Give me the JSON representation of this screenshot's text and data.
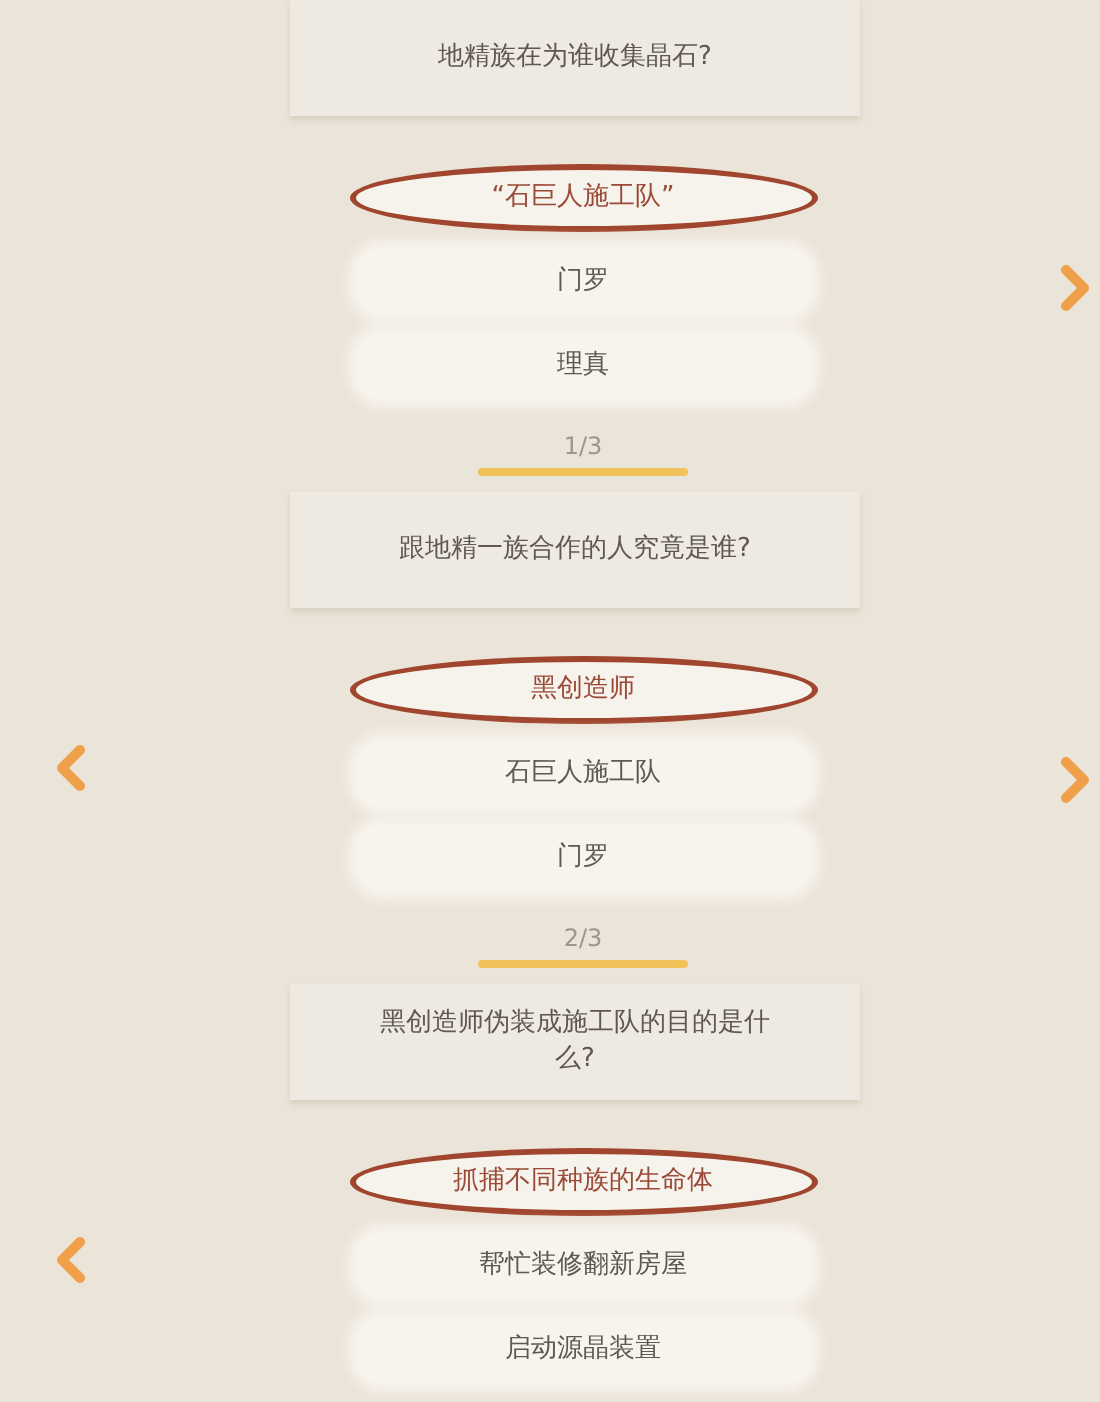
{
  "quizzes": [
    {
      "question": "地精族在为谁收集晶石?",
      "nav_left": false,
      "nav_right": true,
      "options": [
        {
          "label": "“石巨人施工队”",
          "selected": true
        },
        {
          "label": "门罗",
          "selected": false
        },
        {
          "label": "理真",
          "selected": false
        }
      ],
      "progress": "1/3"
    },
    {
      "question": "跟地精一族合作的人究竟是谁?",
      "nav_left": true,
      "nav_right": true,
      "options": [
        {
          "label": "黑创造师",
          "selected": true
        },
        {
          "label": "石巨人施工队",
          "selected": false
        },
        {
          "label": "门罗",
          "selected": false
        }
      ],
      "progress": "2/3"
    },
    {
      "question": "黑创造师伪装成施工队的目的是什么?",
      "nav_left": true,
      "nav_right": false,
      "options": [
        {
          "label": "抓捕不同种族的生命体",
          "selected": true
        },
        {
          "label": "帮忙装修翻新房屋",
          "selected": false
        },
        {
          "label": "启动源晶装置",
          "selected": false
        }
      ]
    }
  ]
}
